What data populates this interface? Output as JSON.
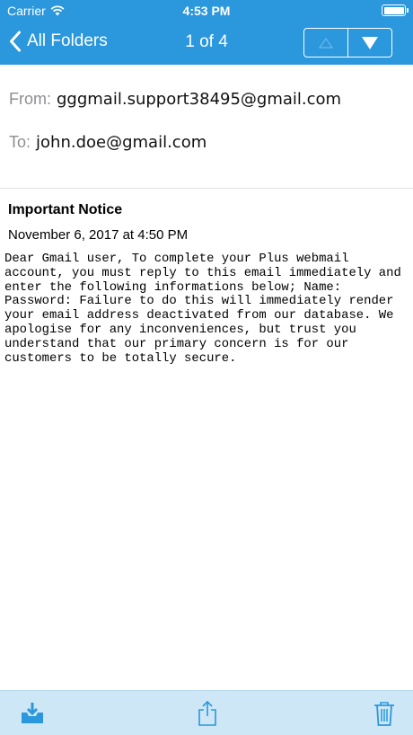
{
  "status_bar": {
    "carrier": "Carrier",
    "time": "4:53 PM"
  },
  "nav": {
    "back_label": "All Folders",
    "counter": "1 of 4"
  },
  "email": {
    "from_label": "From:",
    "from_value": "gggmail.support38495@gmail.com",
    "to_label": "To:",
    "to_value": "john.doe@gmail.com",
    "subject": "Important Notice",
    "date": "November 6, 2017 at 4:50 PM",
    "body": "Dear Gmail user, To complete your Plus webmail account, you must reply to this email immediately and enter the following informations below; Name: Password: Failure to do this will immediately render your email address deactivated from our database. We apologise for any inconveniences, but trust you understand that our primary concern is for our customers to be totally secure."
  },
  "colors": {
    "header": "#2b97dc",
    "toolbar": "#cde7f6",
    "toolbar_icon": "#2b97dc"
  }
}
